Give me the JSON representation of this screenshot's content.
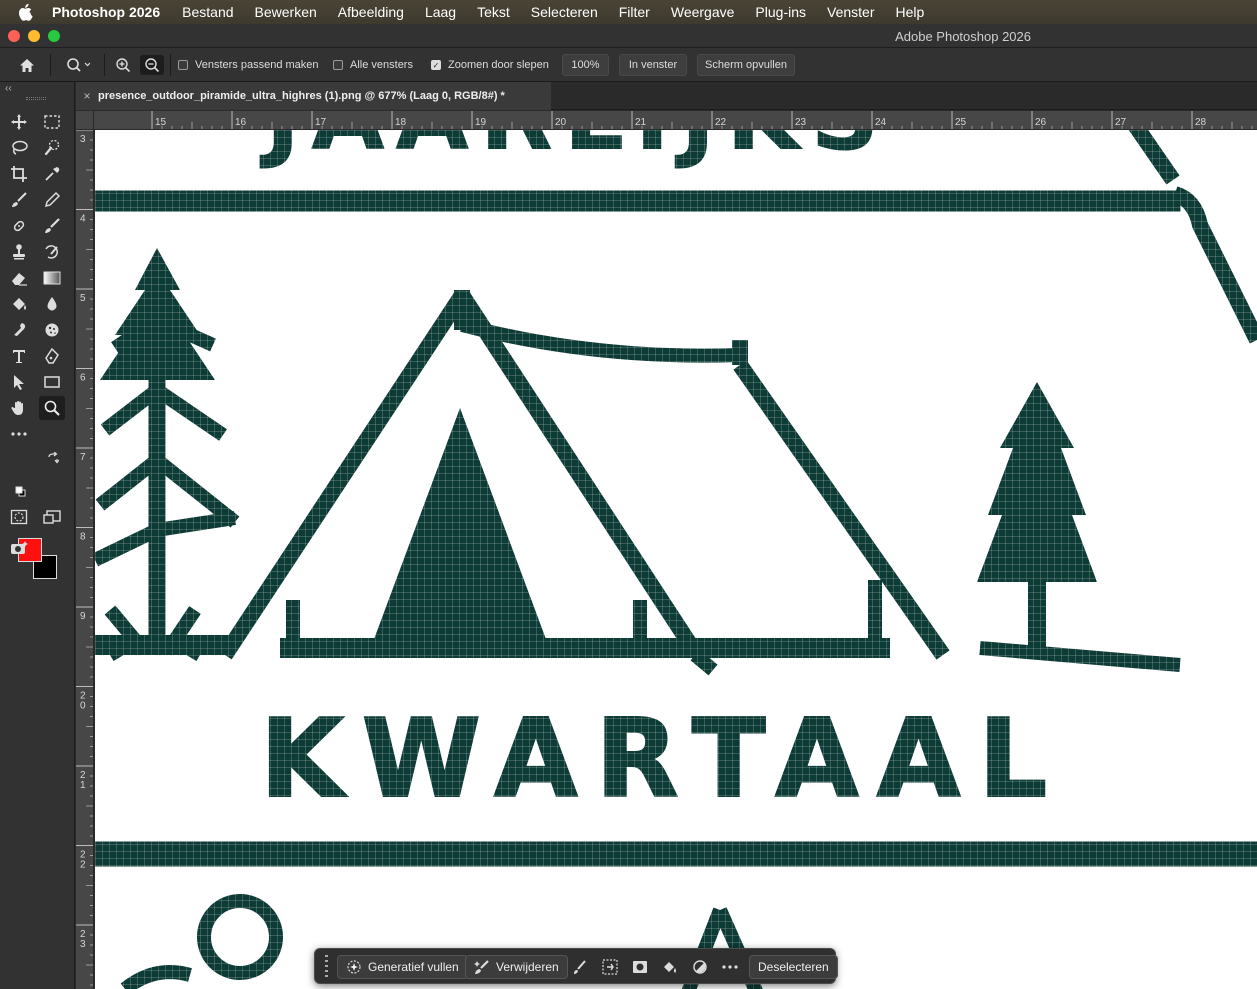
{
  "menubar": {
    "app_name": "Photoshop 2026",
    "items": [
      "Bestand",
      "Bewerken",
      "Afbeelding",
      "Laag",
      "Tekst",
      "Selecteren",
      "Filter",
      "Weergave",
      "Plug-ins",
      "Venster",
      "Help"
    ]
  },
  "titlebar": {
    "title": "Adobe Photoshop 2026"
  },
  "options": {
    "fit_windows_label": "Vensters passend maken",
    "fit_windows_checked": false,
    "all_windows_label": "Alle vensters",
    "all_windows_checked": false,
    "scrubby_zoom_label": "Zoomen door slepen",
    "scrubby_zoom_checked": true,
    "zoom_100_label": "100%",
    "fit_screen_label": "In venster",
    "fill_screen_label": "Scherm opvullen"
  },
  "document": {
    "tab_title": "presence_outdoor_piramide_ultra_highres (1).png @ 677% (Laag 0, RGB/8#) *"
  },
  "ruler": {
    "top": [
      "15",
      "16",
      "17",
      "18",
      "19",
      "20",
      "21",
      "22",
      "23",
      "24",
      "25",
      "26",
      "27",
      "28"
    ],
    "left": [
      "3",
      "4",
      "5",
      "6",
      "7",
      "8",
      "9",
      "20",
      "21",
      "22",
      "23"
    ]
  },
  "canvas": {
    "word_bottom": "KWARTAAL",
    "word_top": "JAARLIJKS",
    "ink_color": "#0d3b35"
  },
  "colors": {
    "foreground": "#fd1010",
    "background": "#000000"
  },
  "taskbar": {
    "generative_fill_label": "Generatief vullen",
    "remove_label": "Verwijderen",
    "deselect_label": "Deselecteren"
  }
}
